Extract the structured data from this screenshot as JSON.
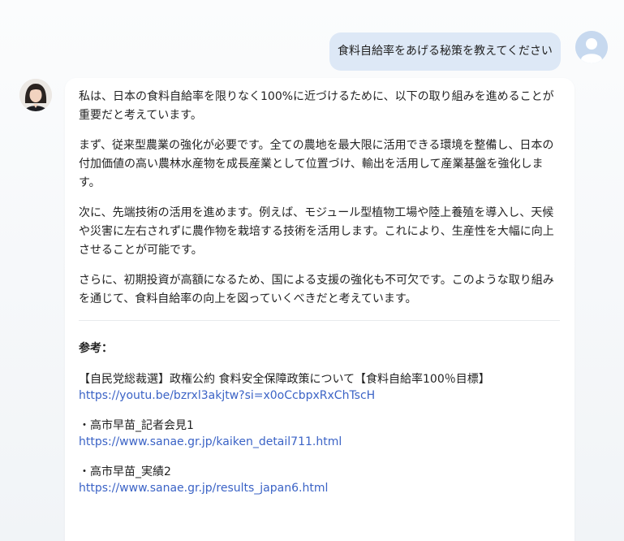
{
  "user_message": {
    "text": "食料自給率をあげる秘策を教えてください"
  },
  "assistant_message": {
    "paragraphs": [
      "私は、日本の食料自給率を限りなく100%に近づけるために、以下の取り組みを進めることが重要だと考えています。",
      "まず、従来型農業の強化が必要です。全ての農地を最大限に活用できる環境を整備し、日本の付加価値の高い農林水産物を成長産業として位置づけ、輸出を活用して産業基盤を強化します。",
      "次に、先端技術の活用を進めます。例えば、モジュール型植物工場や陸上養殖を導入し、天候や災害に左右されずに農作物を栽培する技術を活用します。これにより、生産性を大幅に向上させることが可能です。",
      "さらに、初期投資が高額になるため、国による支援の強化も不可欠です。このような取り組みを通じて、食料自給率の向上を図っていくべきだと考えています。"
    ],
    "references_heading": "参考：",
    "references": [
      {
        "title": "【自民党総裁選】政権公約 食料安全保障政策について【食料自給率100％目標】",
        "url": "https://youtu.be/bzrxl3akjtw?si=x0oCcbpxRxChTscH"
      },
      {
        "title": "・高市早苗_記者会見1",
        "url": "https://www.sanae.gr.jp/kaiken_detail711.html"
      },
      {
        "title": "・高市早苗_実績2",
        "url": "https://www.sanae.gr.jp/results_japan6.html"
      }
    ]
  },
  "colors": {
    "user_bubble": "#dde8f6",
    "user_avatar": "#c7d9ef",
    "link": "#3b63c6",
    "card": "#ffffff"
  },
  "icons": {
    "user_avatar": "user-silhouette-icon",
    "assistant_avatar": "person-portrait-icon"
  }
}
